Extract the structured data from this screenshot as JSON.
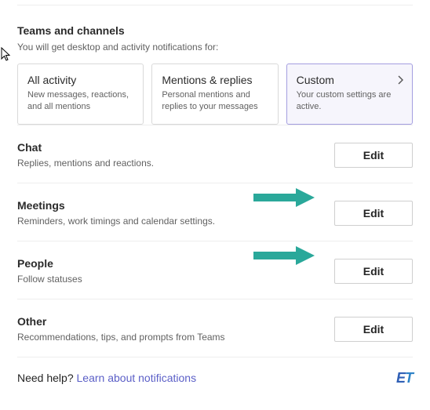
{
  "teams_channels": {
    "title": "Teams and channels",
    "desc": "You will get desktop and activity notifications for:",
    "cards": [
      {
        "title": "All activity",
        "sub": "New messages, reactions, and all mentions"
      },
      {
        "title": "Mentions & replies",
        "sub": "Personal mentions and replies to your messages"
      },
      {
        "title": "Custom",
        "sub": "Your custom settings are active."
      }
    ]
  },
  "rows": {
    "chat": {
      "title": "Chat",
      "desc": "Replies, mentions and reactions.",
      "button": "Edit"
    },
    "meetings": {
      "title": "Meetings",
      "desc": "Reminders, work timings and calendar settings.",
      "button": "Edit"
    },
    "people": {
      "title": "People",
      "desc": "Follow statuses",
      "button": "Edit"
    },
    "other": {
      "title": "Other",
      "desc": "Recommendations, tips, and prompts from Teams",
      "button": "Edit"
    }
  },
  "help": {
    "prefix": "Need help? ",
    "link": "Learn about notifications"
  },
  "logo": {
    "e": "E",
    "t": "T"
  }
}
